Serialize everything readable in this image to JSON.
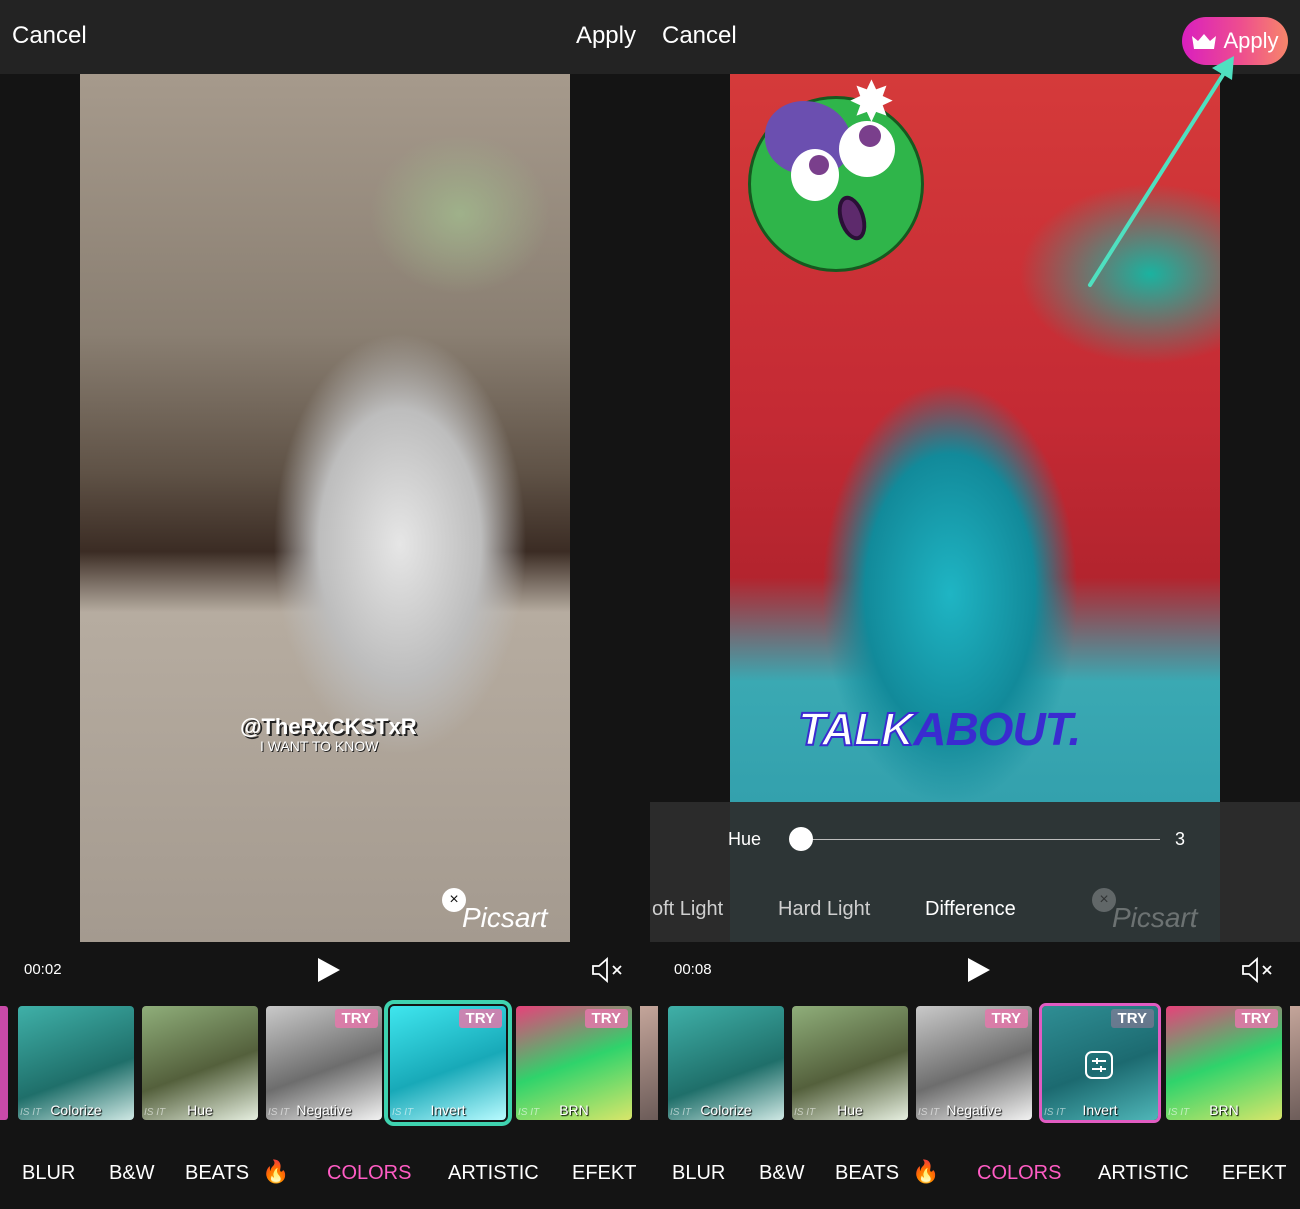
{
  "left": {
    "topbar": {
      "cancel_label": "Cancel",
      "apply_label": "Apply"
    },
    "video": {
      "overlay_handle": "@TheRxCKSTxR",
      "overlay_sub": "I WANT TO KNOW",
      "watermark": "Picsart",
      "watermark_close": "×"
    },
    "player": {
      "time": "00:02"
    },
    "thumbnails": [
      {
        "label": "Colorize",
        "sub": "IS IT",
        "try": ""
      },
      {
        "label": "Hue",
        "sub": "IS IT",
        "try": ""
      },
      {
        "label": "Negative",
        "sub": "IS IT",
        "try": "TRY"
      },
      {
        "label": "Invert",
        "sub": "IS IT",
        "try": "TRY"
      },
      {
        "label": "BRN",
        "sub": "IS IT",
        "try": "TRY"
      }
    ],
    "categories": [
      "BLUR",
      "B&W",
      "BEATS",
      "COLORS",
      "ARTISTIC",
      "EFEKT"
    ],
    "beats_icon": "🔥"
  },
  "right": {
    "topbar": {
      "cancel_label": "Cancel",
      "apply_label": "Apply",
      "apply_icon": "crown-icon"
    },
    "video": {
      "talk_word1": "TALK",
      "talk_word2": "ABOUT.",
      "watermark": "Picsart",
      "watermark_close": "×"
    },
    "adjust": {
      "hue_label": "Hue",
      "hue_value": "3",
      "hue_fraction": 0.03,
      "blend_modes": [
        "oft Light",
        "Hard Light",
        "Difference"
      ],
      "active_blend": "Difference"
    },
    "player": {
      "time": "00:08"
    },
    "thumbnails": [
      {
        "label": "Colorize",
        "sub": "IS IT",
        "try": ""
      },
      {
        "label": "Hue",
        "sub": "IS IT",
        "try": ""
      },
      {
        "label": "Negative",
        "sub": "IS IT",
        "try": "TRY"
      },
      {
        "label": "Invert",
        "sub": "IS IT",
        "try": "TRY"
      },
      {
        "label": "BRN",
        "sub": "IS IT",
        "try": "TRY"
      }
    ],
    "categories": [
      "BLUR",
      "B&W",
      "BEATS",
      "COLORS",
      "ARTISTIC",
      "EFEKT"
    ],
    "beats_icon": "🔥"
  },
  "colors": {
    "active_category": "#ff5cc4",
    "selected_teal": "#3fd3b0",
    "selected_pink": "#e15cc2",
    "arrow": "#4fe0c0",
    "apply_gradient_start": "#d91fbf",
    "apply_gradient_end": "#f7866a"
  }
}
